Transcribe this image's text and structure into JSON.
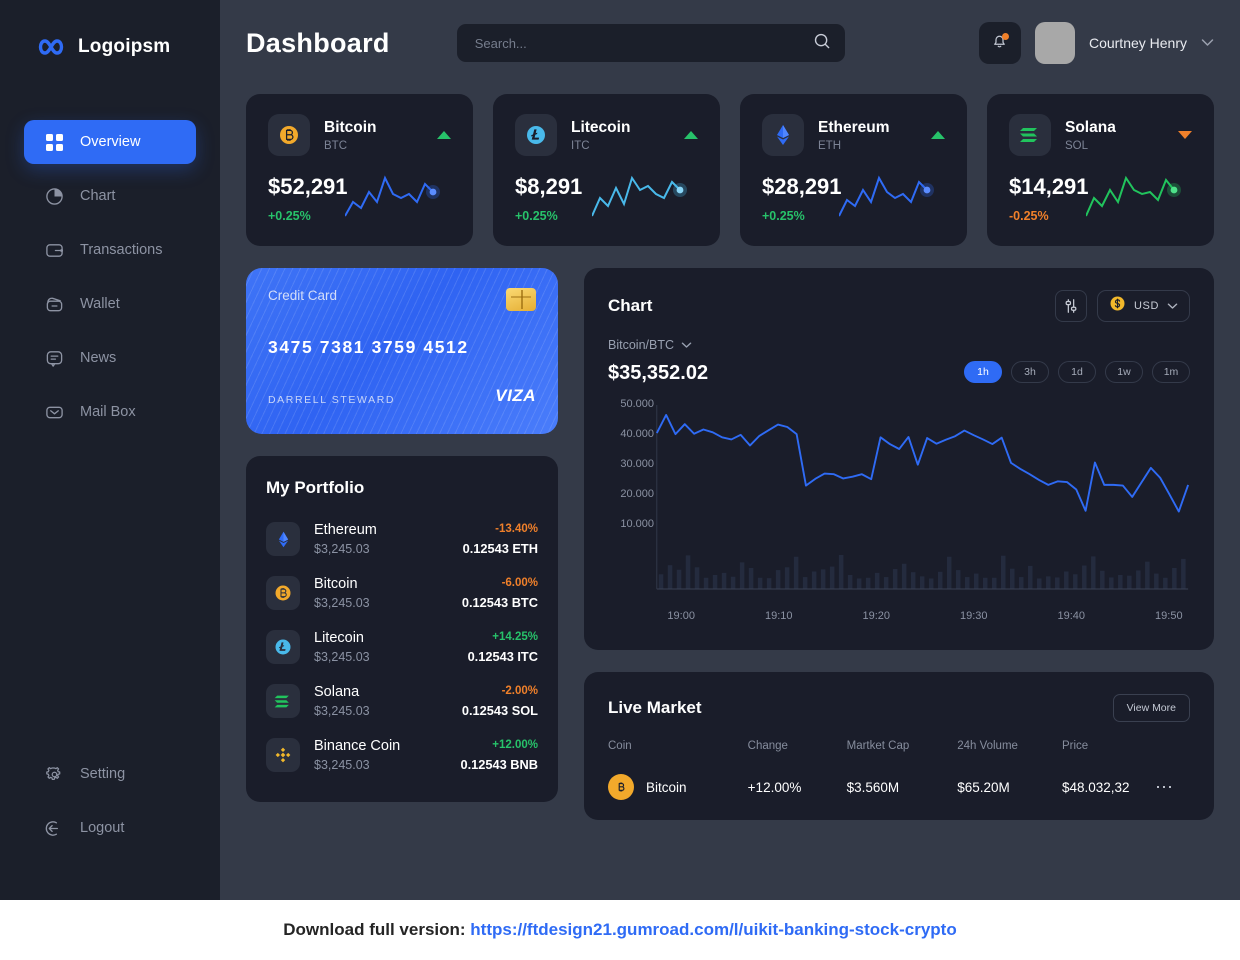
{
  "brand": {
    "name": "Logoipsm",
    "logo_icon": "infinity-logo-icon"
  },
  "sidebar": {
    "items": [
      {
        "label": "Overview",
        "icon": "grid-icon",
        "active": true
      },
      {
        "label": "Chart",
        "icon": "pie-chart-icon",
        "active": false
      },
      {
        "label": "Transactions",
        "icon": "wallet-card-icon",
        "active": false
      },
      {
        "label": "Wallet",
        "icon": "wallet-icon",
        "active": false
      },
      {
        "label": "News",
        "icon": "chat-bubble-icon",
        "active": false
      },
      {
        "label": "Mail Box",
        "icon": "mail-icon",
        "active": false
      }
    ],
    "bottom_items": [
      {
        "label": "Setting",
        "icon": "gear-icon"
      },
      {
        "label": "Logout",
        "icon": "logout-icon"
      }
    ]
  },
  "header": {
    "title": "Dashboard",
    "search_placeholder": "Search...",
    "search_value": "",
    "search_icon": "search-icon",
    "bell_icon": "bell-icon",
    "has_notification": true,
    "user_name": "Courtney Henry",
    "chevron": "⌄"
  },
  "coin_cards": [
    {
      "name": "Bitcoin",
      "symbol": "BTC",
      "price": "$52,291",
      "change": "+0.25%",
      "direction": "up",
      "icon": "bitcoin-icon",
      "accent": "#2f6bf5",
      "icon_color": "#f2a92b"
    },
    {
      "name": "Litecoin",
      "symbol": "ITC",
      "price": "$8,291",
      "change": "+0.25%",
      "direction": "up",
      "icon": "litecoin-icon",
      "accent": "#49b9ea",
      "icon_color": "#49b9ea"
    },
    {
      "name": "Ethereum",
      "symbol": "ETH",
      "price": "$28,291",
      "change": "+0.25%",
      "direction": "up",
      "icon": "ethereum-icon",
      "accent": "#2f6bf5",
      "icon_color": "#2f6bf5"
    },
    {
      "name": "Solana",
      "symbol": "SOL",
      "price": "$14,291",
      "change": "-0.25%",
      "direction": "down",
      "icon": "solana-icon",
      "accent": "#21c45d",
      "icon_color": "#21c45d"
    }
  ],
  "credit_card": {
    "label": "Credit Card",
    "number": "3475 7381 3759 4512",
    "holder": "DARRELL STEWARD",
    "brand": "VIZA",
    "chip_icon": "card-chip-icon",
    "color": "#2f63f2"
  },
  "portfolio": {
    "title": "My Portfolio",
    "rows": [
      {
        "name": "Ethereum",
        "usd": "$3,245.03",
        "pct": "-13.40%",
        "pct_sign": "neg",
        "amount": "0.12543 ETH",
        "icon": "ethereum-icon",
        "icon_color": "#2f6bf5"
      },
      {
        "name": "Bitcoin",
        "usd": "$3,245.03",
        "pct": "-6.00%",
        "pct_sign": "neg",
        "amount": "0.12543 BTC",
        "icon": "bitcoin-icon",
        "icon_color": "#f2a92b"
      },
      {
        "name": "Litecoin",
        "usd": "$3,245.03",
        "pct": "+14.25%",
        "pct_sign": "pos",
        "amount": "0.12543 ITC",
        "icon": "litecoin-icon",
        "icon_color": "#49b9ea"
      },
      {
        "name": "Solana",
        "usd": "$3,245.03",
        "pct": "-2.00%",
        "pct_sign": "neg",
        "amount": "0.12543 SOL",
        "icon": "solana-icon",
        "icon_color": "#21c45d"
      },
      {
        "name": "Binance Coin",
        "usd": "$3,245.03",
        "pct": "+12.00%",
        "pct_sign": "pos",
        "amount": "0.12543 BNB",
        "icon": "binance-icon",
        "icon_color": "#f2b82b"
      }
    ]
  },
  "chart_panel": {
    "title": "Chart",
    "settings_icon": "sliders-icon",
    "currency": "USD",
    "currency_icon": "dollar-coin-icon",
    "currency_chevron": "⌄",
    "pair": "Bitcoin/BTC",
    "pair_chevron": "⌄",
    "price": "$35,352.02",
    "ranges": [
      {
        "label": "1h",
        "active": true
      },
      {
        "label": "3h",
        "active": false
      },
      {
        "label": "1d",
        "active": false
      },
      {
        "label": "1w",
        "active": false
      },
      {
        "label": "1m",
        "active": false
      }
    ]
  },
  "chart_data": {
    "type": "line",
    "title": "Bitcoin/BTC",
    "xlabel": "",
    "ylabel": "",
    "grid": false,
    "legend": "none",
    "ylim": [
      10000,
      50000
    ],
    "ytick_labels": [
      "50.000",
      "40.000",
      "30.000",
      "20.000",
      "10.000"
    ],
    "ytick_values": [
      50000,
      40000,
      30000,
      20000,
      10000
    ],
    "xtick_labels": [
      "19:00",
      "19:10",
      "19:20",
      "19:30",
      "19:40",
      "19:50"
    ],
    "xtick_values": [
      0,
      10,
      20,
      30,
      40,
      50
    ],
    "line_color": "#2f6bf5",
    "volume_bar_color": "#242b3e",
    "series": [
      {
        "name": "Price",
        "values": [
          42100,
          47200,
          41800,
          44600,
          41900,
          43100,
          42300,
          40900,
          40300,
          41600,
          38600,
          41300,
          42900,
          44500,
          43800,
          41800,
          27300,
          29200,
          30700,
          30500,
          29300,
          29800,
          30500,
          29100,
          40900,
          39000,
          37600,
          41000,
          33200,
          40700,
          39100,
          40200,
          41200,
          42800,
          41500,
          40300,
          39000,
          40800,
          33700,
          32000,
          30500,
          28900,
          27500,
          28500,
          28300,
          26200,
          20200,
          33800,
          27500,
          27500,
          27300,
          24100,
          28200,
          32300,
          29500,
          24800,
          20000,
          27500
        ]
      }
    ],
    "volume_bars": [
      4200,
      6800,
      5500,
      9600,
      6200,
      3200,
      4000,
      4600,
      3500,
      7600,
      6000,
      3200,
      3100,
      5400,
      6200,
      9200,
      3400,
      5000,
      5600,
      6400,
      9700,
      4000,
      3000,
      3200,
      4600,
      3400,
      5700,
      7200,
      4800,
      3600,
      3000,
      4900,
      9200,
      5400,
      3400,
      4400,
      3200,
      3200,
      9500,
      5800,
      3400,
      6600,
      3000,
      3600,
      3300,
      5000,
      4200,
      6700,
      9300,
      5200,
      3300,
      4000,
      3800,
      5300,
      7800,
      4400,
      3200,
      6000,
      8600
    ]
  },
  "live_market": {
    "title": "Live Market",
    "view_more": "View More",
    "columns": [
      "Coin",
      "Change",
      "Martket Cap",
      "24h Volume",
      "Price",
      ""
    ],
    "rows": [
      {
        "coin": "Bitcoin",
        "coin_icon": "bitcoin-icon",
        "change": "+12.00%",
        "change_sign": "pos",
        "market_cap": "$3.560M",
        "volume_24h": "$65.20M",
        "price": "$48.032,32",
        "menu_icon": "more-horizontal-icon"
      }
    ]
  },
  "footer": {
    "prefix": "Download full version: ",
    "link": "https://ftdesign21.gumroad.com/l/uikit-banking-stock-crypto"
  }
}
